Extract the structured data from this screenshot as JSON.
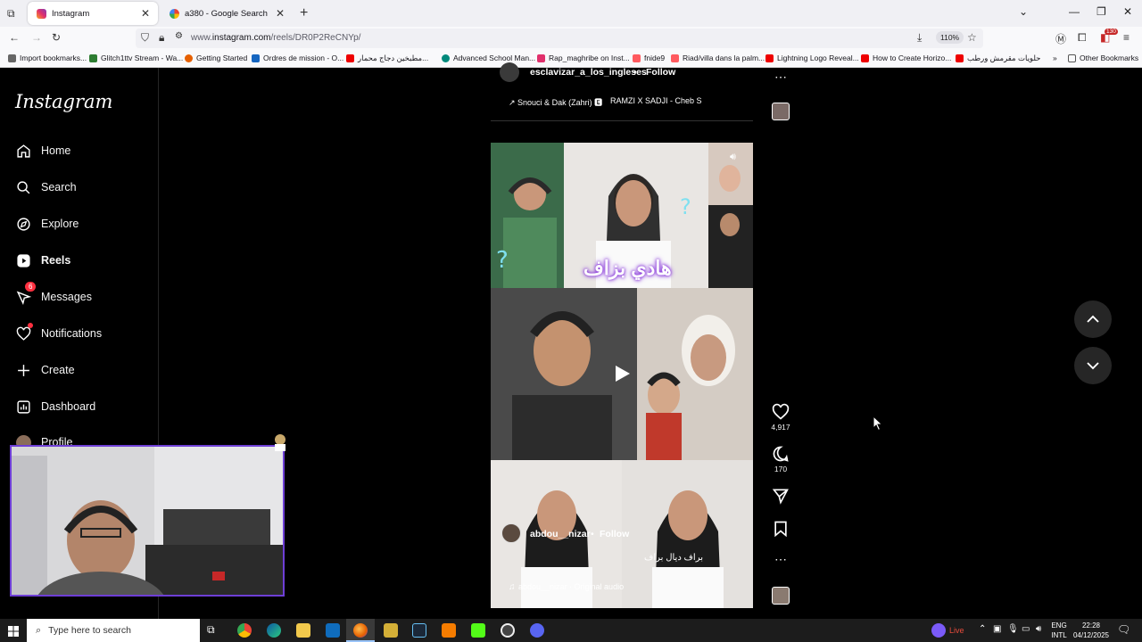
{
  "browser": {
    "tabs": [
      {
        "label": "Instagram",
        "active": true
      },
      {
        "label": "a380 - Google Search",
        "active": false
      }
    ],
    "url_prefix": "www.",
    "url_domain": "instagram.com",
    "url_path": "/reels/DR0P2ReCNYp/",
    "zoom": "110%",
    "bookmarks": [
      "Import bookmarks...",
      "Glitch1ttv Stream - Wa...",
      "Getting Started",
      "Ordres de mission - O...",
      "مطبخين دجاج محمار...",
      "Advanced School Man...",
      "Rap_maghribe on Inst...",
      "fnide9",
      "Riad/villa dans la palm...",
      "Lightning Logo Reveal...",
      "How to Create Horizo...",
      "حلويات مقرمش ورطب",
      "Other Bookmarks"
    ],
    "extension_badge": "130"
  },
  "sidebar": {
    "logo": "Instagram",
    "items": [
      {
        "label": "Home",
        "icon": "home-icon"
      },
      {
        "label": "Search",
        "icon": "search-icon"
      },
      {
        "label": "Explore",
        "icon": "compass-icon"
      },
      {
        "label": "Reels",
        "icon": "reels-icon"
      },
      {
        "label": "Messages",
        "icon": "messenger-icon",
        "badge": "6"
      },
      {
        "label": "Notifications",
        "icon": "heart-icon"
      },
      {
        "label": "Create",
        "icon": "plus-icon"
      },
      {
        "label": "Dashboard",
        "icon": "dashboard-icon"
      },
      {
        "label": "Profile",
        "icon": "avatar"
      }
    ]
  },
  "previous_reel": {
    "username": "esclavizar_a_los_ingleses",
    "follow": "Follow",
    "audio": "↗ Snouci & Dak (Zahri) 🅴",
    "audio2": "RAMZI X SADJI - Cheb S"
  },
  "reel": {
    "title_overlay": "هادي بزاف",
    "caption_overlay": "براف ديال براف",
    "username": "abdou__nizar",
    "follow": "Follow",
    "separator": "•",
    "audio": "abdou__nizar · Original audio",
    "likes": "4,917",
    "comments": "170"
  },
  "taskbar": {
    "search_placeholder": "Type here to search",
    "live": "Live",
    "lang1": "ENG",
    "lang2": "INTL",
    "time": "22:28",
    "date": "04/12/2025"
  }
}
